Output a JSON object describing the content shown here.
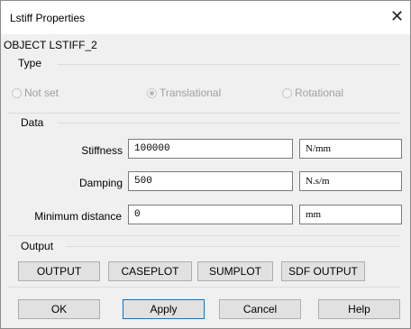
{
  "window": {
    "title": "Lstiff Properties",
    "close_glyph": "✕"
  },
  "object_label": "OBJECT LSTIFF_2",
  "type_group": {
    "label": "Type",
    "options": [
      {
        "label": "Not set",
        "selected": false
      },
      {
        "label": "Translational",
        "selected": true
      },
      {
        "label": "Rotational",
        "selected": false
      }
    ]
  },
  "data_group": {
    "label": "Data",
    "fields": [
      {
        "label": "Stiffness",
        "value": "100000",
        "unit": "N/mm"
      },
      {
        "label": "Damping",
        "value": "500",
        "unit": "N.s/m"
      },
      {
        "label": "Minimum distance",
        "value": "0",
        "unit": "mm"
      }
    ]
  },
  "output_group": {
    "label": "Output",
    "buttons": [
      "OUTPUT",
      "CASEPLOT",
      "SUMPLOT",
      "SDF OUTPUT"
    ]
  },
  "footer": {
    "ok": "OK",
    "apply": "Apply",
    "cancel": "Cancel",
    "help": "Help"
  }
}
